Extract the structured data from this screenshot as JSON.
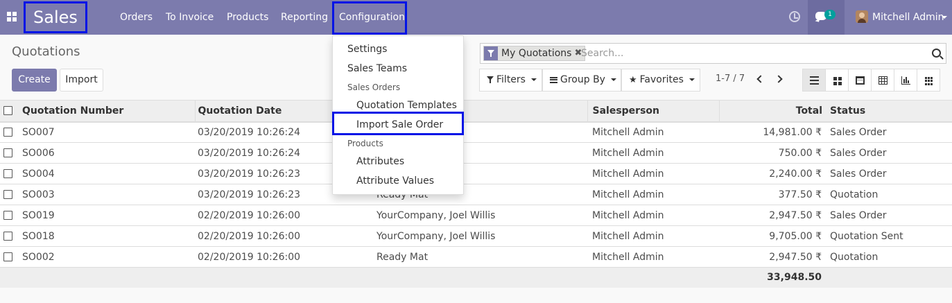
{
  "topbar": {
    "app_name": "Sales",
    "menu": [
      "Orders",
      "To Invoice",
      "Products",
      "Reporting",
      "Configuration"
    ],
    "chat_badge": "1",
    "user_name": "Mitchell Admin",
    "colors": {
      "navbar": "#7c7bad",
      "highlight_border": "#0014e6",
      "badge": "#00a09d"
    }
  },
  "control_panel": {
    "breadcrumb": "Quotations",
    "create_label": "Create",
    "import_label": "Import",
    "search": {
      "facet": "My Quotations",
      "facet_remove": "✖",
      "placeholder": "Search..."
    },
    "filters_label": "Filters",
    "groupby_label": "Group By",
    "favorites_label": "Favorites",
    "pager": "1-7 / 7",
    "views": [
      "list-view-icon",
      "kanban-view-icon",
      "calendar-view-icon",
      "pivot-view-icon",
      "graph-view-icon",
      "activity-view-icon"
    ]
  },
  "table": {
    "headers": {
      "number": "Quotation Number",
      "date": "Quotation Date",
      "customer": "",
      "salesperson": "Salesperson",
      "total": "Total",
      "status": "Status"
    },
    "rows": [
      {
        "number": "SO007",
        "date": "03/20/2019 10:26:24",
        "customer": "",
        "salesperson": "Mitchell Admin",
        "total": "14,981.00 ₹",
        "status": "Sales Order"
      },
      {
        "number": "SO006",
        "date": "03/20/2019 10:26:24",
        "customer": "",
        "salesperson": "Mitchell Admin",
        "total": "750.00 ₹",
        "status": "Sales Order"
      },
      {
        "number": "SO004",
        "date": "03/20/2019 10:26:23",
        "customer": "",
        "salesperson": "Mitchell Admin",
        "total": "2,240.00 ₹",
        "status": "Sales Order"
      },
      {
        "number": "SO003",
        "date": "03/20/2019 10:26:23",
        "customer": "Ready Mat",
        "salesperson": "Mitchell Admin",
        "total": "377.50 ₹",
        "status": "Quotation"
      },
      {
        "number": "SO019",
        "date": "02/20/2019 10:26:00",
        "customer": "YourCompany, Joel Willis",
        "salesperson": "Mitchell Admin",
        "total": "2,947.50 ₹",
        "status": "Sales Order"
      },
      {
        "number": "SO018",
        "date": "02/20/2019 10:26:00",
        "customer": "YourCompany, Joel Willis",
        "salesperson": "Mitchell Admin",
        "total": "9,705.00 ₹",
        "status": "Quotation Sent"
      },
      {
        "number": "SO002",
        "date": "02/20/2019 10:26:00",
        "customer": "Ready Mat",
        "salesperson": "Mitchell Admin",
        "total": "2,947.50 ₹",
        "status": "Quotation"
      }
    ],
    "footer_total": "33,948.50"
  },
  "config_dropdown": {
    "settings": "Settings",
    "sales_teams": "Sales Teams",
    "sales_orders_header": "Sales Orders",
    "quotation_templates": "Quotation Templates",
    "import_sale_order": "Import Sale Order",
    "products_header": "Products",
    "attributes": "Attributes",
    "attribute_values": "Attribute Values"
  }
}
